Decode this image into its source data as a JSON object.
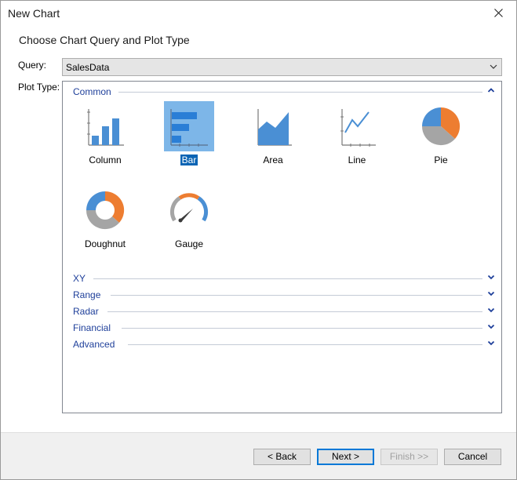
{
  "window": {
    "title": "New Chart"
  },
  "heading": "Choose Chart Query and Plot Type",
  "query": {
    "label": "Query:",
    "value": "SalesData"
  },
  "plot_type": {
    "label": "Plot Type:",
    "groups": [
      {
        "label": "Common",
        "expanded": true
      },
      {
        "label": "XY",
        "expanded": false
      },
      {
        "label": "Range",
        "expanded": false
      },
      {
        "label": "Radar",
        "expanded": false
      },
      {
        "label": "Financial",
        "expanded": false
      },
      {
        "label": "Advanced",
        "expanded": false
      }
    ],
    "common_items": [
      {
        "label": "Column",
        "icon": "column-chart-icon",
        "selected": false
      },
      {
        "label": "Bar",
        "icon": "bar-chart-icon",
        "selected": true
      },
      {
        "label": "Area",
        "icon": "area-chart-icon",
        "selected": false
      },
      {
        "label": "Line",
        "icon": "line-chart-icon",
        "selected": false
      },
      {
        "label": "Pie",
        "icon": "pie-chart-icon",
        "selected": false
      },
      {
        "label": "Doughnut",
        "icon": "doughnut-chart-icon",
        "selected": false
      },
      {
        "label": "Gauge",
        "icon": "gauge-chart-icon",
        "selected": false
      }
    ]
  },
  "buttons": {
    "back": "< Back",
    "next": "Next >",
    "finish": "Finish >>",
    "cancel": "Cancel"
  },
  "colors": {
    "accent_blue": "#4a8fd4",
    "orange": "#ed7d31",
    "gray": "#a5a5a5",
    "group_text": "#1e3f9a",
    "selection": "#7db6e8"
  }
}
